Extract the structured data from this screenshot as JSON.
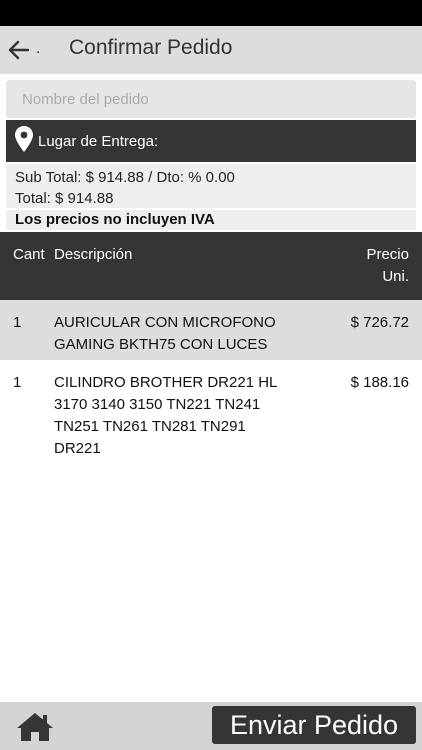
{
  "header": {
    "title": "Confirmar Pedido",
    "back_suffix": "."
  },
  "order_name": {
    "placeholder": "Nombre del pedido",
    "icon_glyph": ""
  },
  "delivery": {
    "label": "Lugar de Entrega:"
  },
  "totals": {
    "subtotal_line": "Sub Total: $ 914.88 / Dto: % 0.00",
    "total_line": "Total: $ 914.88"
  },
  "notice": "Los precios no incluyen IVA",
  "table": {
    "columns": {
      "qty": "Cant",
      "description": "Descripción",
      "price": "Precio Uni."
    },
    "rows": [
      {
        "qty": "1",
        "description": "AURICULAR CON MICROFONO GAMING BKTH75 CON LUCES",
        "price": "$ 726.72"
      },
      {
        "qty": "1",
        "description": "CILINDRO BROTHER DR221 HL 3170 3140 3150 TN221 TN241 TN251 TN261 TN281 TN291 DR221",
        "price": "$ 188.16"
      }
    ]
  },
  "footer": {
    "send_label": "Enviar Pedido"
  },
  "colors": {
    "header_bg": "#dddddd",
    "dark_bar": "#333537",
    "row_alt": "#dddddd"
  }
}
